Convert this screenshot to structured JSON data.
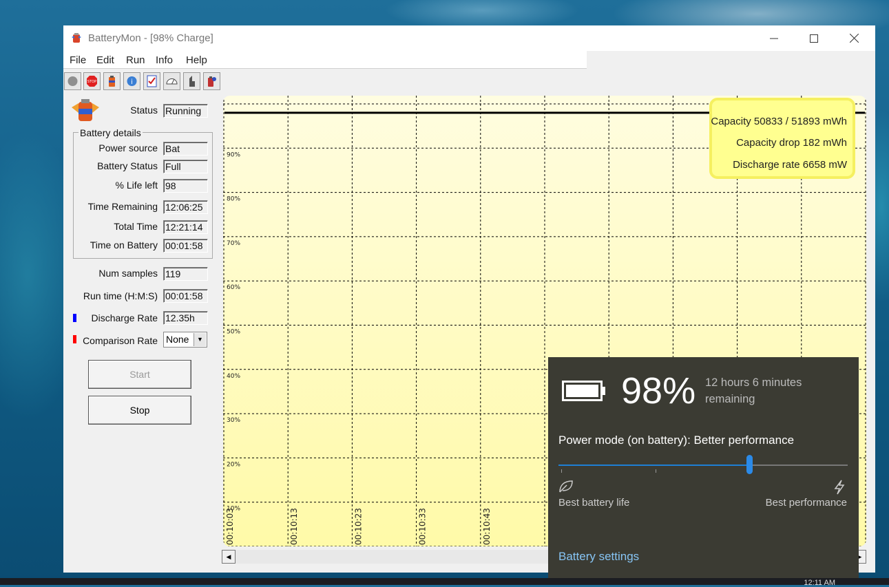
{
  "window": {
    "title": "BatteryMon - [98% Charge]",
    "minimize_icon": "minimize-icon",
    "maximize_icon": "maximize-icon",
    "close_icon": "close-icon"
  },
  "menu": [
    "File",
    "Edit",
    "Run",
    "Info",
    "Help"
  ],
  "toolbar": [
    "record-icon",
    "stop-sign-icon",
    "battery-icon",
    "battery-info-icon",
    "checklist-icon",
    "gauge-icon",
    "pointer-icon",
    "battery-settings-icon"
  ],
  "status": {
    "label": "Status",
    "value": "Running"
  },
  "battery_details": {
    "title": "Battery details",
    "rows": [
      {
        "label": "Power source",
        "value": "Bat"
      },
      {
        "label": "Battery Status",
        "value": "Full"
      },
      {
        "label": "% Life left",
        "value": "98"
      },
      {
        "label": "Time Remaining",
        "value": "12:06:25"
      },
      {
        "label": "Total Time",
        "value": "12:21:14"
      },
      {
        "label": "Time on Battery",
        "value": "00:01:58"
      }
    ]
  },
  "stats": {
    "num_samples": {
      "label": "Num samples",
      "value": "119"
    },
    "run_time": {
      "label": "Run time (H:M:S)",
      "value": "00:01:58"
    },
    "discharge_rate": {
      "label": "Discharge Rate",
      "value": "12.35h",
      "color": "#0000ff"
    },
    "comparison_rate": {
      "label": "Comparison Rate",
      "value": "None",
      "color": "#ff0000"
    }
  },
  "buttons": {
    "start": "Start",
    "stop": "Stop"
  },
  "chart_data": {
    "type": "line",
    "y_ticks": [
      "90%",
      "80%",
      "70%",
      "60%",
      "50%",
      "40%",
      "30%",
      "20%",
      "10%"
    ],
    "x_ticks": [
      "00:10:03",
      "00:10:13",
      "00:10:23",
      "00:10:33",
      "00:10:43"
    ],
    "ylim": [
      0,
      100
    ],
    "grid": true,
    "series": [
      {
        "values": [
          98,
          98,
          98,
          98,
          98,
          98,
          98,
          98,
          98,
          98
        ],
        "color": "#000000"
      }
    ]
  },
  "info_box": {
    "capacity": "Capacity 50833 / 51893 mWh",
    "capacity_drop": "Capacity drop 182 mWh",
    "discharge_rate": "Discharge rate 6658 mW"
  },
  "flyout": {
    "percent": "98%",
    "remaining_line1": "12 hours 6 minutes",
    "remaining_line2": "remaining",
    "power_mode": "Power mode (on battery): Better performance",
    "slider_level": 0.66,
    "best_battery": "Best battery life",
    "best_performance": "Best performance",
    "settings_link": "Battery settings",
    "accent": "#1e7fd6"
  },
  "taskbar": {
    "clock": "12:11 AM"
  }
}
